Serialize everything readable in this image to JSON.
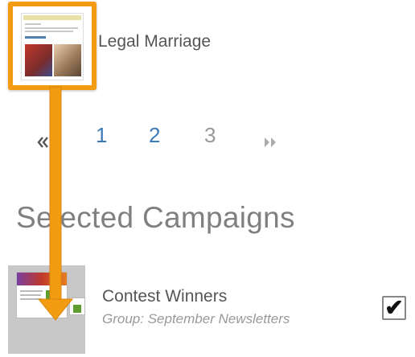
{
  "top_campaign": {
    "name": "Legal Marriage"
  },
  "pagination": {
    "prev_icon": "double-chevron-left-icon",
    "pages": [
      "1",
      "2",
      "3"
    ],
    "current": "3",
    "next_icon": "double-chevron-right-icon"
  },
  "selected": {
    "heading": "Selected Campaigns",
    "items": [
      {
        "name": "Contest Winners",
        "group": "Group: September Newsletters",
        "checked": true,
        "check_glyph": "✔"
      }
    ]
  },
  "annotation": {
    "arrow_color": "#f39c12",
    "arrow_icon": "drag-down-arrow-icon"
  },
  "colors": {
    "accent": "#f39c12",
    "link": "#3d7ab8",
    "heading": "#808080"
  }
}
